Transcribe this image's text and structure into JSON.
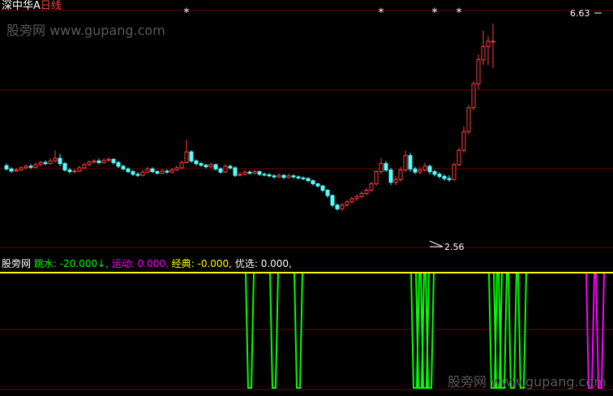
{
  "title": {
    "stock": "深中华A",
    "period": "日线",
    "stock_color": "#ffffff",
    "period_color": "#ff4040"
  },
  "watermark": {
    "top": "股旁网 www.gupang.com",
    "bottom": "股旁网 www.gupang.com"
  },
  "indicator": {
    "source": "股旁网",
    "items": [
      {
        "label": "跳水:",
        "value": "-20.000↓,",
        "color": "#00ff00"
      },
      {
        "label": "运动:",
        "value": "0.000,",
        "color": "#ff00ff"
      },
      {
        "label": "经典:",
        "value": "-0.000,",
        "color": "#ffff00"
      },
      {
        "label": "优选:",
        "value": "0.000,",
        "color": "#ffffff"
      }
    ]
  },
  "price_labels": {
    "high": "6.63",
    "low": "2.56"
  },
  "colors": {
    "up": "#ff4040",
    "down": "#55ffff",
    "grid": "#6a0000",
    "signal_green": "#00ff00",
    "signal_magenta": "#ff00ff",
    "line_yellow": "#ffff00",
    "marker": "#ffffff"
  },
  "chart_data": {
    "type": "candlestick",
    "price_range": [
      2.5,
      6.8
    ],
    "candles": [
      {
        "o": 3.96,
        "c": 3.9,
        "h": 4.0,
        "l": 3.87
      },
      {
        "o": 3.9,
        "c": 3.86,
        "h": 3.93,
        "l": 3.83
      },
      {
        "o": 3.86,
        "c": 3.88,
        "h": 3.92,
        "l": 3.84
      },
      {
        "o": 3.88,
        "c": 3.92,
        "h": 3.95,
        "l": 3.86
      },
      {
        "o": 3.92,
        "c": 3.95,
        "h": 3.98,
        "l": 3.9
      },
      {
        "o": 3.95,
        "c": 3.93,
        "h": 3.99,
        "l": 3.9
      },
      {
        "o": 3.93,
        "c": 3.98,
        "h": 4.02,
        "l": 3.91
      },
      {
        "o": 3.98,
        "c": 4.02,
        "h": 4.05,
        "l": 3.95
      },
      {
        "o": 4.02,
        "c": 4.0,
        "h": 4.06,
        "l": 3.97
      },
      {
        "o": 4.0,
        "c": 4.05,
        "h": 4.1,
        "l": 3.98
      },
      {
        "o": 4.05,
        "c": 4.1,
        "h": 4.25,
        "l": 4.02
      },
      {
        "o": 4.1,
        "c": 4.0,
        "h": 4.18,
        "l": 3.95
      },
      {
        "o": 4.0,
        "c": 3.88,
        "h": 4.03,
        "l": 3.85
      },
      {
        "o": 3.88,
        "c": 3.85,
        "h": 3.92,
        "l": 3.81
      },
      {
        "o": 3.85,
        "c": 3.86,
        "h": 3.9,
        "l": 3.82
      },
      {
        "o": 3.86,
        "c": 3.92,
        "h": 3.96,
        "l": 3.84
      },
      {
        "o": 3.92,
        "c": 3.98,
        "h": 4.02,
        "l": 3.9
      },
      {
        "o": 3.98,
        "c": 4.03,
        "h": 4.06,
        "l": 3.95
      },
      {
        "o": 4.03,
        "c": 4.05,
        "h": 4.08,
        "l": 4.0
      },
      {
        "o": 4.05,
        "c": 4.02,
        "h": 4.09,
        "l": 3.99
      },
      {
        "o": 4.02,
        "c": 4.06,
        "h": 4.1,
        "l": 4.0
      },
      {
        "o": 4.06,
        "c": 4.08,
        "h": 4.12,
        "l": 4.03
      },
      {
        "o": 4.08,
        "c": 4.02,
        "h": 4.1,
        "l": 3.98
      },
      {
        "o": 4.02,
        "c": 3.95,
        "h": 4.05,
        "l": 3.92
      },
      {
        "o": 3.95,
        "c": 3.9,
        "h": 3.98,
        "l": 3.87
      },
      {
        "o": 3.9,
        "c": 3.85,
        "h": 3.93,
        "l": 3.82
      },
      {
        "o": 3.85,
        "c": 3.8,
        "h": 3.88,
        "l": 3.77
      },
      {
        "o": 3.8,
        "c": 3.78,
        "h": 3.84,
        "l": 3.75
      },
      {
        "o": 3.78,
        "c": 3.84,
        "h": 3.88,
        "l": 3.76
      },
      {
        "o": 3.84,
        "c": 3.9,
        "h": 3.94,
        "l": 3.82
      },
      {
        "o": 3.9,
        "c": 3.85,
        "h": 3.93,
        "l": 3.82
      },
      {
        "o": 3.85,
        "c": 3.82,
        "h": 3.88,
        "l": 3.79
      },
      {
        "o": 3.82,
        "c": 3.86,
        "h": 3.9,
        "l": 3.8
      },
      {
        "o": 3.86,
        "c": 3.84,
        "h": 3.89,
        "l": 3.81
      },
      {
        "o": 3.84,
        "c": 3.88,
        "h": 3.92,
        "l": 3.82
      },
      {
        "o": 3.88,
        "c": 3.92,
        "h": 3.96,
        "l": 3.86
      },
      {
        "o": 3.92,
        "c": 4.02,
        "h": 4.06,
        "l": 3.9
      },
      {
        "o": 4.02,
        "c": 4.22,
        "h": 4.45,
        "l": 4.0
      },
      {
        "o": 4.22,
        "c": 4.05,
        "h": 4.25,
        "l": 4.02
      },
      {
        "o": 4.05,
        "c": 4.0,
        "h": 4.08,
        "l": 3.96
      },
      {
        "o": 4.0,
        "c": 3.97,
        "h": 4.03,
        "l": 3.94
      },
      {
        "o": 3.97,
        "c": 3.94,
        "h": 4.0,
        "l": 3.91
      },
      {
        "o": 3.94,
        "c": 3.98,
        "h": 4.02,
        "l": 3.92
      },
      {
        "o": 3.98,
        "c": 3.9,
        "h": 4.0,
        "l": 3.87
      },
      {
        "o": 3.9,
        "c": 3.84,
        "h": 3.93,
        "l": 3.81
      },
      {
        "o": 3.84,
        "c": 3.95,
        "h": 3.99,
        "l": 3.82
      },
      {
        "o": 3.95,
        "c": 3.92,
        "h": 3.98,
        "l": 3.89
      },
      {
        "o": 3.92,
        "c": 3.78,
        "h": 3.95,
        "l": 3.75
      },
      {
        "o": 3.78,
        "c": 3.8,
        "h": 3.84,
        "l": 3.76
      },
      {
        "o": 3.8,
        "c": 3.84,
        "h": 3.88,
        "l": 3.78
      },
      {
        "o": 3.84,
        "c": 3.82,
        "h": 3.87,
        "l": 3.79
      },
      {
        "o": 3.82,
        "c": 3.85,
        "h": 3.88,
        "l": 3.8
      },
      {
        "o": 3.85,
        "c": 3.8,
        "h": 3.87,
        "l": 3.77
      },
      {
        "o": 3.8,
        "c": 3.79,
        "h": 3.83,
        "l": 3.76
      },
      {
        "o": 3.79,
        "c": 3.77,
        "h": 3.82,
        "l": 3.74
      },
      {
        "o": 3.77,
        "c": 3.75,
        "h": 3.8,
        "l": 3.72
      },
      {
        "o": 3.75,
        "c": 3.78,
        "h": 3.82,
        "l": 3.73
      },
      {
        "o": 3.78,
        "c": 3.74,
        "h": 3.8,
        "l": 3.71
      },
      {
        "o": 3.74,
        "c": 3.77,
        "h": 3.81,
        "l": 3.72
      },
      {
        "o": 3.77,
        "c": 3.75,
        "h": 3.8,
        "l": 3.72
      },
      {
        "o": 3.75,
        "c": 3.73,
        "h": 3.78,
        "l": 3.7
      },
      {
        "o": 3.73,
        "c": 3.72,
        "h": 3.76,
        "l": 3.69
      },
      {
        "o": 3.72,
        "c": 3.68,
        "h": 3.74,
        "l": 3.65
      },
      {
        "o": 3.68,
        "c": 3.62,
        "h": 3.7,
        "l": 3.59
      },
      {
        "o": 3.62,
        "c": 3.58,
        "h": 3.64,
        "l": 3.55
      },
      {
        "o": 3.58,
        "c": 3.5,
        "h": 3.6,
        "l": 3.46
      },
      {
        "o": 3.5,
        "c": 3.4,
        "h": 3.52,
        "l": 3.36
      },
      {
        "o": 3.4,
        "c": 3.22,
        "h": 3.42,
        "l": 3.18
      },
      {
        "o": 3.22,
        "c": 3.15,
        "h": 3.25,
        "l": 3.12
      },
      {
        "o": 3.15,
        "c": 3.22,
        "h": 3.26,
        "l": 3.12
      },
      {
        "o": 3.22,
        "c": 3.28,
        "h": 3.32,
        "l": 3.19
      },
      {
        "o": 3.28,
        "c": 3.34,
        "h": 3.38,
        "l": 3.25
      },
      {
        "o": 3.34,
        "c": 3.38,
        "h": 3.42,
        "l": 3.3
      },
      {
        "o": 3.38,
        "c": 3.44,
        "h": 3.48,
        "l": 3.35
      },
      {
        "o": 3.44,
        "c": 3.5,
        "h": 3.54,
        "l": 3.4
      },
      {
        "o": 3.5,
        "c": 3.62,
        "h": 3.66,
        "l": 3.47
      },
      {
        "o": 3.62,
        "c": 3.85,
        "h": 3.88,
        "l": 3.58
      },
      {
        "o": 3.85,
        "c": 4.0,
        "h": 4.1,
        "l": 3.8
      },
      {
        "o": 4.0,
        "c": 3.88,
        "h": 4.05,
        "l": 3.84
      },
      {
        "o": 3.88,
        "c": 3.65,
        "h": 3.92,
        "l": 3.6
      },
      {
        "o": 3.65,
        "c": 3.7,
        "h": 3.76,
        "l": 3.6
      },
      {
        "o": 3.7,
        "c": 3.88,
        "h": 3.94,
        "l": 3.66
      },
      {
        "o": 3.88,
        "c": 4.15,
        "h": 4.25,
        "l": 3.84
      },
      {
        "o": 4.15,
        "c": 3.9,
        "h": 4.2,
        "l": 3.85
      },
      {
        "o": 3.9,
        "c": 3.84,
        "h": 3.94,
        "l": 3.8
      },
      {
        "o": 3.84,
        "c": 3.88,
        "h": 3.94,
        "l": 3.8
      },
      {
        "o": 3.88,
        "c": 3.95,
        "h": 4.02,
        "l": 3.85
      },
      {
        "o": 3.95,
        "c": 3.85,
        "h": 3.98,
        "l": 3.8
      },
      {
        "o": 3.85,
        "c": 3.8,
        "h": 3.88,
        "l": 3.76
      },
      {
        "o": 3.8,
        "c": 3.76,
        "h": 3.84,
        "l": 3.72
      },
      {
        "o": 3.76,
        "c": 3.72,
        "h": 3.8,
        "l": 3.68
      },
      {
        "o": 3.72,
        "c": 3.7,
        "h": 3.78,
        "l": 3.66
      },
      {
        "o": 3.7,
        "c": 3.98,
        "h": 4.02,
        "l": 3.68
      },
      {
        "o": 3.98,
        "c": 4.25,
        "h": 4.3,
        "l": 3.95
      },
      {
        "o": 4.25,
        "c": 4.6,
        "h": 4.7,
        "l": 4.2
      },
      {
        "o": 4.6,
        "c": 5.05,
        "h": 5.1,
        "l": 4.55
      },
      {
        "o": 5.05,
        "c": 5.5,
        "h": 5.55,
        "l": 5.0
      },
      {
        "o": 5.5,
        "c": 5.95,
        "h": 6.05,
        "l": 5.4
      },
      {
        "o": 5.95,
        "c": 6.2,
        "h": 6.5,
        "l": 5.85
      },
      {
        "o": 6.2,
        "c": 6.3,
        "h": 6.4,
        "l": 5.85
      },
      {
        "o": 6.3,
        "c": 6.3,
        "h": 6.63,
        "l": 5.8
      }
    ],
    "markers": [
      {
        "index": 37,
        "label": "*"
      },
      {
        "index": 77,
        "label": "*"
      },
      {
        "index": 88,
        "label": "*"
      },
      {
        "index": 93,
        "label": "*"
      }
    ],
    "indicator_pulses": [
      {
        "index": 50,
        "color": "green"
      },
      {
        "index": 55,
        "color": "green"
      },
      {
        "index": 60,
        "color": "green"
      },
      {
        "index": 84,
        "color": "green"
      },
      {
        "index": 85,
        "color": "green"
      },
      {
        "index": 86,
        "color": "green"
      },
      {
        "index": 87,
        "color": "green"
      },
      {
        "index": 100,
        "color": "green"
      },
      {
        "index": 101,
        "color": "green"
      },
      {
        "index": 102,
        "color": "green"
      },
      {
        "index": 104,
        "color": "green"
      },
      {
        "index": 106,
        "color": "green"
      },
      {
        "index": 120,
        "color": "magenta"
      },
      {
        "index": 122,
        "color": "magenta"
      }
    ]
  }
}
